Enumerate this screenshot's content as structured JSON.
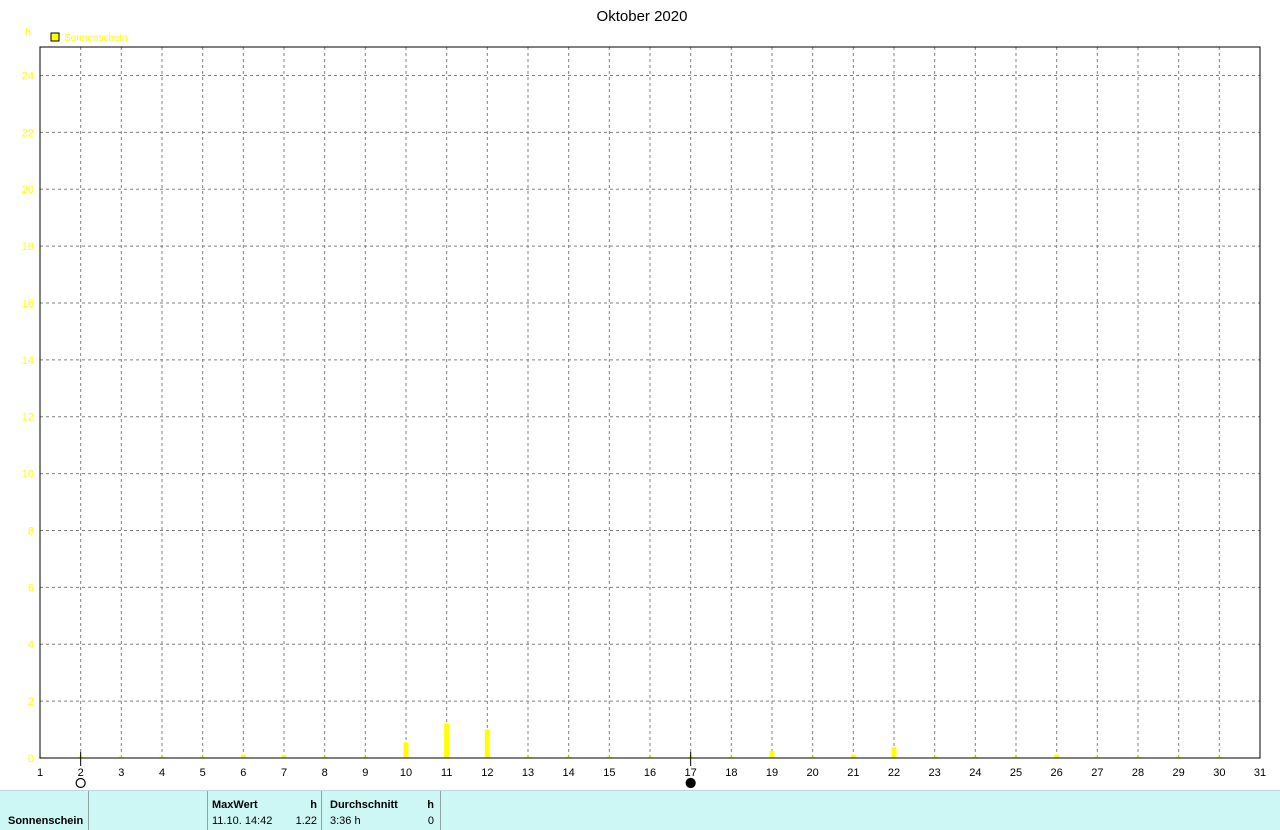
{
  "colors": {
    "series": "#ffff00",
    "axis": "#000000",
    "grid": "#808080",
    "footer_bg": "#ccf7f4"
  },
  "chart_data": {
    "type": "bar",
    "title": "Oktober 2020",
    "ylabel": "h",
    "ylim": [
      0,
      25
    ],
    "yticks": [
      0,
      2,
      4,
      6,
      8,
      10,
      12,
      14,
      16,
      18,
      20,
      22,
      24
    ],
    "x": [
      1,
      2,
      3,
      4,
      5,
      6,
      7,
      8,
      9,
      10,
      11,
      12,
      13,
      14,
      15,
      16,
      17,
      18,
      19,
      20,
      21,
      22,
      23,
      24,
      25,
      26,
      27,
      28,
      29,
      30,
      31
    ],
    "xlim": [
      1,
      31
    ],
    "grid": true,
    "legend": "top-left",
    "series": [
      {
        "name": "Sonnenschein",
        "bars": [
          {
            "x": 1,
            "y": 0.03
          },
          {
            "x": 2,
            "y": 0.05
          },
          {
            "x": 3,
            "y": 0.05
          },
          {
            "x": 4,
            "y": 0.05
          },
          {
            "x": 5,
            "y": 0.05
          },
          {
            "x": 6,
            "y": 0.12
          },
          {
            "x": 7,
            "y": 0.1
          },
          {
            "x": 8,
            "y": 0.05
          },
          {
            "x": 9,
            "y": 0.05
          },
          {
            "x": 10,
            "y": 0.55
          },
          {
            "x": 11,
            "y": 1.22
          },
          {
            "x": 12,
            "y": 1.0
          },
          {
            "x": 13,
            "y": 0.05
          },
          {
            "x": 14,
            "y": 0.05
          },
          {
            "x": 15,
            "y": 0.05
          },
          {
            "x": 16,
            "y": 0.05
          },
          {
            "x": 17,
            "y": 0.05
          },
          {
            "x": 18,
            "y": 0.05
          },
          {
            "x": 19,
            "y": 0.25
          },
          {
            "x": 20,
            "y": 0.05
          },
          {
            "x": 21,
            "y": 0.12
          },
          {
            "x": 22,
            "y": 0.38
          },
          {
            "x": 23,
            "y": 0.05
          },
          {
            "x": 24,
            "y": 0.05
          },
          {
            "x": 25,
            "y": 0.05
          },
          {
            "x": 26,
            "y": 0.12
          },
          {
            "x": 27,
            "y": 0.05
          },
          {
            "x": 28,
            "y": 0.05
          },
          {
            "x": 29,
            "y": 0.05
          },
          {
            "x": 30,
            "y": 0.05
          }
        ]
      }
    ],
    "moon_phases": [
      {
        "day": 2,
        "phase": "full-moon"
      },
      {
        "day": 17,
        "phase": "new-moon"
      }
    ]
  },
  "footer": {
    "series_name": "Sonnenschein",
    "maxwert_header": "MaxWert",
    "maxwert_unit": "h",
    "maxwert_time": "11.10.  14:42",
    "maxwert_value": "1.22",
    "durchschnitt_header": "Durchschnitt",
    "durchschnitt_unit": "h",
    "durchschnitt_value": "3:36 h",
    "durchschnitt_extra": "0"
  }
}
